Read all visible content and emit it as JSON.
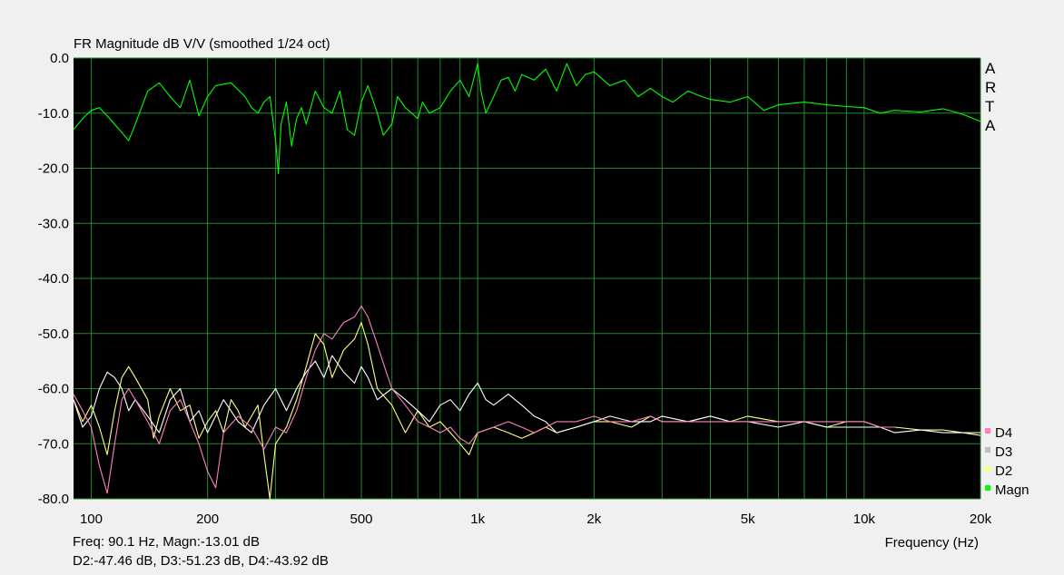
{
  "chart_data": {
    "type": "line",
    "title": "FR Magnitude dB V/V (smoothed 1/24 oct)",
    "xlabel": "Frequency (Hz)",
    "ylabel": "",
    "x_scale": "log",
    "xlim": [
      90,
      20000
    ],
    "ylim": [
      -80,
      0
    ],
    "grid": true,
    "legend_position": "bottom-right",
    "watermark": "ARTA",
    "x_tick_labels": [
      {
        "value": 100,
        "label": "100"
      },
      {
        "value": 200,
        "label": "200"
      },
      {
        "value": 500,
        "label": "500"
      },
      {
        "value": 1000,
        "label": "1k"
      },
      {
        "value": 2000,
        "label": "2k"
      },
      {
        "value": 5000,
        "label": "5k"
      },
      {
        "value": 10000,
        "label": "10k"
      },
      {
        "value": 20000,
        "label": "20k"
      }
    ],
    "y_tick_labels": [
      {
        "value": 0,
        "label": "0.0"
      },
      {
        "value": -10,
        "label": "-10.0"
      },
      {
        "value": -20,
        "label": "-20.0"
      },
      {
        "value": -30,
        "label": "-30.0"
      },
      {
        "value": -40,
        "label": "-40.0"
      },
      {
        "value": -50,
        "label": "-50.0"
      },
      {
        "value": -60,
        "label": "-60.0"
      },
      {
        "value": -70,
        "label": "-70.0"
      },
      {
        "value": -80,
        "label": "-80.0"
      }
    ],
    "series": [
      {
        "name": "Magn",
        "color": "#00ff00",
        "points": [
          [
            90,
            -13
          ],
          [
            95,
            -11
          ],
          [
            100,
            -9.5
          ],
          [
            105,
            -9
          ],
          [
            110,
            -10.5
          ],
          [
            120,
            -13.5
          ],
          [
            125,
            -15
          ],
          [
            130,
            -12
          ],
          [
            140,
            -6
          ],
          [
            150,
            -4.5
          ],
          [
            160,
            -7
          ],
          [
            170,
            -9
          ],
          [
            180,
            -4
          ],
          [
            190,
            -10.5
          ],
          [
            200,
            -7
          ],
          [
            210,
            -5
          ],
          [
            230,
            -4.5
          ],
          [
            250,
            -7
          ],
          [
            260,
            -9
          ],
          [
            270,
            -10
          ],
          [
            280,
            -8
          ],
          [
            290,
            -7
          ],
          [
            300,
            -15
          ],
          [
            305,
            -21
          ],
          [
            310,
            -12
          ],
          [
            320,
            -8
          ],
          [
            330,
            -16
          ],
          [
            340,
            -11
          ],
          [
            350,
            -9
          ],
          [
            360,
            -12
          ],
          [
            380,
            -6
          ],
          [
            400,
            -9
          ],
          [
            420,
            -10
          ],
          [
            440,
            -6
          ],
          [
            460,
            -13
          ],
          [
            480,
            -14
          ],
          [
            500,
            -8
          ],
          [
            520,
            -5
          ],
          [
            550,
            -10
          ],
          [
            570,
            -14
          ],
          [
            600,
            -12
          ],
          [
            620,
            -7
          ],
          [
            650,
            -9
          ],
          [
            700,
            -11
          ],
          [
            720,
            -8
          ],
          [
            750,
            -10
          ],
          [
            800,
            -9
          ],
          [
            850,
            -6
          ],
          [
            900,
            -4
          ],
          [
            950,
            -7
          ],
          [
            1000,
            -1
          ],
          [
            1020,
            -6
          ],
          [
            1050,
            -10
          ],
          [
            1100,
            -7
          ],
          [
            1150,
            -4
          ],
          [
            1200,
            -3.5
          ],
          [
            1250,
            -6
          ],
          [
            1300,
            -3
          ],
          [
            1400,
            -4
          ],
          [
            1500,
            -2
          ],
          [
            1600,
            -6
          ],
          [
            1700,
            -1
          ],
          [
            1800,
            -5
          ],
          [
            1900,
            -3
          ],
          [
            2000,
            -2.5
          ],
          [
            2200,
            -5
          ],
          [
            2400,
            -4
          ],
          [
            2600,
            -7
          ],
          [
            2800,
            -5.5
          ],
          [
            3000,
            -7
          ],
          [
            3200,
            -8
          ],
          [
            3500,
            -6
          ],
          [
            3800,
            -7
          ],
          [
            4000,
            -7.5
          ],
          [
            4500,
            -8
          ],
          [
            5000,
            -7
          ],
          [
            5500,
            -9.5
          ],
          [
            6000,
            -8.5
          ],
          [
            7000,
            -8
          ],
          [
            8000,
            -8.5
          ],
          [
            9000,
            -8.8
          ],
          [
            10000,
            -9
          ],
          [
            11000,
            -10
          ],
          [
            12000,
            -9.5
          ],
          [
            14000,
            -9.8
          ],
          [
            16000,
            -9.2
          ],
          [
            18000,
            -10.2
          ],
          [
            20000,
            -11.5
          ]
        ]
      },
      {
        "name": "D2",
        "color": "#ffff80",
        "points": [
          [
            90,
            -62
          ],
          [
            95,
            -66
          ],
          [
            100,
            -63
          ],
          [
            105,
            -67
          ],
          [
            110,
            -72
          ],
          [
            115,
            -64
          ],
          [
            120,
            -58
          ],
          [
            125,
            -56
          ],
          [
            130,
            -58
          ],
          [
            140,
            -62
          ],
          [
            145,
            -69
          ],
          [
            150,
            -65
          ],
          [
            160,
            -60
          ],
          [
            170,
            -64
          ],
          [
            180,
            -63
          ],
          [
            190,
            -69
          ],
          [
            200,
            -66
          ],
          [
            210,
            -64
          ],
          [
            220,
            -68
          ],
          [
            230,
            -62
          ],
          [
            240,
            -64
          ],
          [
            250,
            -67
          ],
          [
            260,
            -65
          ],
          [
            270,
            -63
          ],
          [
            280,
            -72
          ],
          [
            290,
            -80
          ],
          [
            300,
            -70
          ],
          [
            320,
            -67
          ],
          [
            340,
            -62
          ],
          [
            360,
            -56
          ],
          [
            380,
            -50
          ],
          [
            400,
            -52
          ],
          [
            420,
            -58
          ],
          [
            450,
            -53
          ],
          [
            480,
            -51
          ],
          [
            500,
            -48
          ],
          [
            520,
            -52
          ],
          [
            550,
            -60
          ],
          [
            600,
            -63
          ],
          [
            650,
            -68
          ],
          [
            700,
            -64
          ],
          [
            750,
            -67
          ],
          [
            800,
            -66
          ],
          [
            850,
            -68
          ],
          [
            900,
            -70
          ],
          [
            950,
            -72
          ],
          [
            1000,
            -68
          ],
          [
            1100,
            -67
          ],
          [
            1200,
            -68
          ],
          [
            1300,
            -69
          ],
          [
            1400,
            -68
          ],
          [
            1500,
            -67
          ],
          [
            1600,
            -68
          ],
          [
            1800,
            -67
          ],
          [
            2000,
            -66
          ],
          [
            2200,
            -66
          ],
          [
            2500,
            -67
          ],
          [
            2800,
            -65
          ],
          [
            3000,
            -66
          ],
          [
            3500,
            -66
          ],
          [
            4000,
            -65
          ],
          [
            4500,
            -66
          ],
          [
            5000,
            -65
          ],
          [
            6000,
            -66
          ],
          [
            7000,
            -66
          ],
          [
            8000,
            -67
          ],
          [
            9000,
            -66
          ],
          [
            10000,
            -66
          ],
          [
            11000,
            -67
          ],
          [
            12000,
            -67
          ],
          [
            14000,
            -67.5
          ],
          [
            16000,
            -67.5
          ],
          [
            18000,
            -68
          ],
          [
            20000,
            -68
          ]
        ]
      },
      {
        "name": "D3",
        "color": "#ffffff",
        "points": [
          [
            90,
            -62
          ],
          [
            95,
            -67
          ],
          [
            100,
            -65
          ],
          [
            105,
            -60
          ],
          [
            110,
            -57
          ],
          [
            115,
            -58
          ],
          [
            120,
            -60
          ],
          [
            125,
            -64
          ],
          [
            130,
            -62
          ],
          [
            140,
            -65
          ],
          [
            150,
            -68
          ],
          [
            160,
            -62
          ],
          [
            170,
            -60
          ],
          [
            180,
            -66
          ],
          [
            190,
            -64
          ],
          [
            200,
            -68
          ],
          [
            220,
            -62
          ],
          [
            240,
            -66
          ],
          [
            260,
            -68
          ],
          [
            280,
            -63
          ],
          [
            300,
            -60
          ],
          [
            320,
            -64
          ],
          [
            340,
            -60
          ],
          [
            360,
            -57
          ],
          [
            380,
            -55
          ],
          [
            400,
            -58
          ],
          [
            420,
            -54
          ],
          [
            450,
            -57
          ],
          [
            480,
            -59
          ],
          [
            500,
            -56
          ],
          [
            520,
            -58
          ],
          [
            550,
            -62
          ],
          [
            600,
            -60
          ],
          [
            650,
            -62
          ],
          [
            700,
            -64
          ],
          [
            750,
            -66
          ],
          [
            800,
            -63
          ],
          [
            850,
            -62
          ],
          [
            900,
            -64
          ],
          [
            950,
            -61
          ],
          [
            1000,
            -59
          ],
          [
            1050,
            -62
          ],
          [
            1100,
            -63
          ],
          [
            1200,
            -61
          ],
          [
            1300,
            -63
          ],
          [
            1400,
            -65
          ],
          [
            1500,
            -66
          ],
          [
            1600,
            -68
          ],
          [
            1800,
            -67
          ],
          [
            2000,
            -66
          ],
          [
            2200,
            -65
          ],
          [
            2500,
            -66
          ],
          [
            2800,
            -66
          ],
          [
            3000,
            -65
          ],
          [
            3500,
            -66
          ],
          [
            4000,
            -65
          ],
          [
            4500,
            -66
          ],
          [
            5000,
            -66
          ],
          [
            6000,
            -67
          ],
          [
            7000,
            -66
          ],
          [
            8000,
            -67
          ],
          [
            9000,
            -67
          ],
          [
            10000,
            -67
          ],
          [
            11000,
            -67
          ],
          [
            12000,
            -68
          ],
          [
            14000,
            -67.5
          ],
          [
            16000,
            -68
          ],
          [
            18000,
            -68
          ],
          [
            20000,
            -68.5
          ]
        ]
      },
      {
        "name": "D4",
        "color": "#ff80c0",
        "points": [
          [
            90,
            -61
          ],
          [
            95,
            -64
          ],
          [
            100,
            -67
          ],
          [
            105,
            -74
          ],
          [
            110,
            -79
          ],
          [
            115,
            -70
          ],
          [
            120,
            -62
          ],
          [
            125,
            -60
          ],
          [
            130,
            -62
          ],
          [
            140,
            -66
          ],
          [
            150,
            -70
          ],
          [
            160,
            -64
          ],
          [
            170,
            -62
          ],
          [
            180,
            -66
          ],
          [
            190,
            -70
          ],
          [
            200,
            -75
          ],
          [
            210,
            -78
          ],
          [
            220,
            -68
          ],
          [
            240,
            -65
          ],
          [
            260,
            -67
          ],
          [
            280,
            -71
          ],
          [
            300,
            -67
          ],
          [
            320,
            -68
          ],
          [
            340,
            -64
          ],
          [
            360,
            -58
          ],
          [
            380,
            -53
          ],
          [
            400,
            -50
          ],
          [
            420,
            -51
          ],
          [
            450,
            -48
          ],
          [
            480,
            -47
          ],
          [
            500,
            -45
          ],
          [
            520,
            -47
          ],
          [
            550,
            -52
          ],
          [
            580,
            -57
          ],
          [
            600,
            -60
          ],
          [
            650,
            -63
          ],
          [
            700,
            -66
          ],
          [
            750,
            -67
          ],
          [
            800,
            -68
          ],
          [
            850,
            -67
          ],
          [
            900,
            -69
          ],
          [
            950,
            -70
          ],
          [
            1000,
            -68
          ],
          [
            1100,
            -67
          ],
          [
            1200,
            -66
          ],
          [
            1300,
            -67
          ],
          [
            1400,
            -68
          ],
          [
            1500,
            -67
          ],
          [
            1600,
            -66
          ],
          [
            1800,
            -66
          ],
          [
            2000,
            -65
          ],
          [
            2200,
            -66
          ],
          [
            2500,
            -66
          ],
          [
            2800,
            -65
          ],
          [
            3000,
            -66
          ],
          [
            3500,
            -66
          ],
          [
            4000,
            -66
          ],
          [
            4500,
            -66
          ],
          [
            5000,
            -66
          ],
          [
            6000,
            -66
          ],
          [
            7000,
            -66
          ],
          [
            8000,
            -66
          ],
          [
            9000,
            -66
          ],
          [
            10000,
            -66
          ],
          [
            11000,
            -67
          ],
          [
            12000,
            -67
          ]
        ]
      }
    ],
    "legend": [
      {
        "name": "D4",
        "color": "#ff80c0"
      },
      {
        "name": "D3",
        "color": "#c0c0c0"
      },
      {
        "name": "D2",
        "color": "#ffff80"
      },
      {
        "name": "Magn",
        "color": "#00ff00"
      }
    ]
  },
  "status": {
    "line1": "Freq: 90.1 Hz, Magn:-13.01 dB",
    "line2": "D2:-47.46 dB, D3:-51.23 dB, D4:-43.92 dB"
  }
}
